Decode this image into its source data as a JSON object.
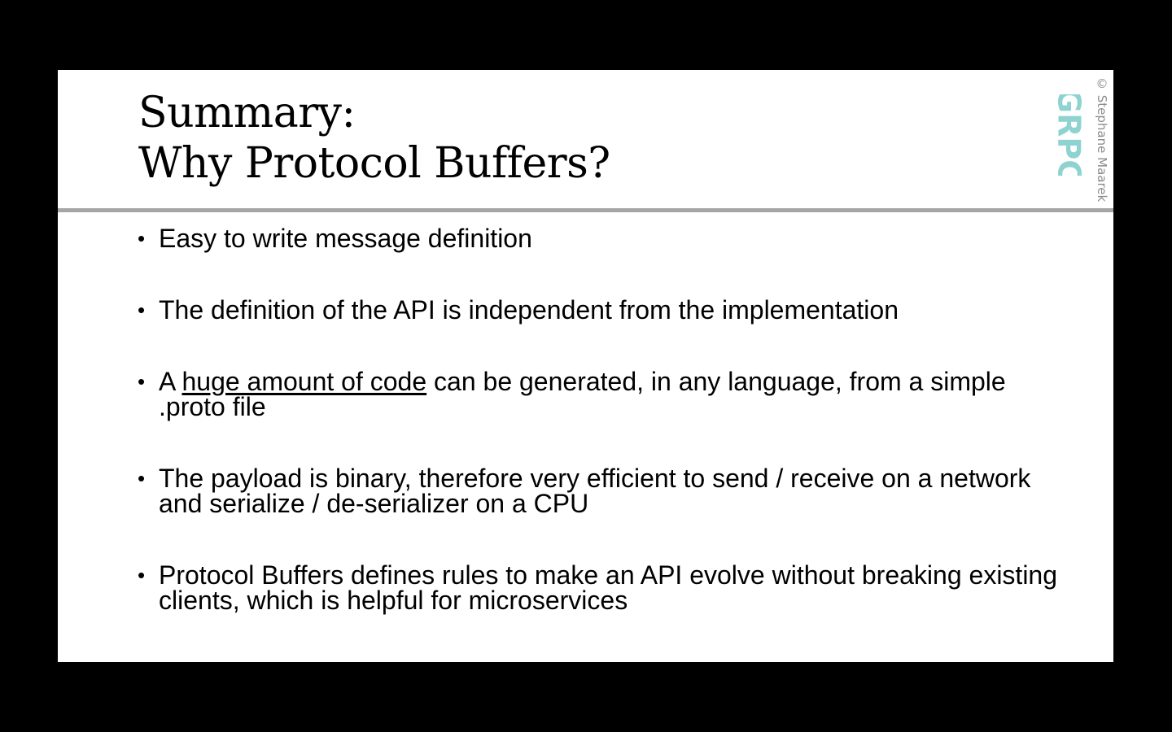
{
  "slide": {
    "title_line1": "Summary:",
    "title_line2": "Why Protocol Buffers?",
    "copyright": "© Stephane Maarek",
    "logo_text": "GRPC",
    "bullet_glyph": "•",
    "bullets": [
      {
        "text": "Easy to write message definition"
      },
      {
        "text": "The definition of the API is independent from the implementation"
      },
      {
        "prefix": "A ",
        "link": "huge amount of code",
        "suffix": " can be generated, in any language, from a simple .proto file"
      },
      {
        "text": "The payload is binary, therefore very efficient to send / receive on a network and serialize / de-serializer on a CPU"
      },
      {
        "text": "Protocol Buffers defines rules to make an API evolve without breaking existing clients, which is helpful for microservices"
      }
    ]
  },
  "colors": {
    "background": "#000000",
    "slide": "#ffffff",
    "divider": "#a6a6a6",
    "logo": "#8fd3d1",
    "copyright": "#8c8c8c"
  }
}
